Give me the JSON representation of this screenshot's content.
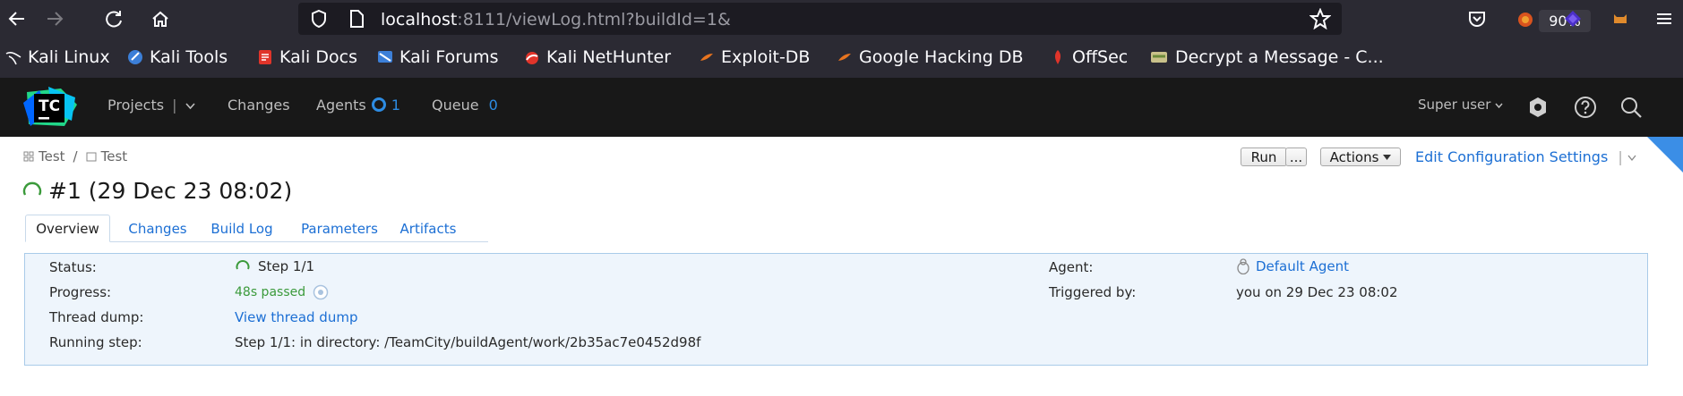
{
  "browser": {
    "url_host": "localhost",
    "url_rest": ":8111/viewLog.html?buildId=1&",
    "zoom": "90%",
    "bookmarks": [
      {
        "label": "Kali Linux",
        "icon": "kali-dragon-icon"
      },
      {
        "label": "Kali Tools",
        "icon": "kali-tools-icon"
      },
      {
        "label": "Kali Docs",
        "icon": "kali-docs-icon"
      },
      {
        "label": "Kali Forums",
        "icon": "kali-forums-icon"
      },
      {
        "label": "Kali NetHunter",
        "icon": "nethunter-icon"
      },
      {
        "label": "Exploit-DB",
        "icon": "exploit-db-icon"
      },
      {
        "label": "Google Hacking DB",
        "icon": "ghdb-icon"
      },
      {
        "label": "OffSec",
        "icon": "offsec-icon"
      },
      {
        "label": "Decrypt a Message - C...",
        "icon": "decrypt-icon"
      }
    ]
  },
  "header": {
    "logo_text": "TC",
    "projects": "Projects",
    "changes": "Changes",
    "agents": "Agents",
    "agents_count": "1",
    "queue": "Queue",
    "queue_count": "0",
    "user": "Super user"
  },
  "breadcrumb": {
    "project": "Test",
    "separator": "/",
    "config": "Test"
  },
  "build": {
    "title": "#1 (29 Dec 23 08:02)"
  },
  "toolbar": {
    "run": "Run",
    "run_more": "...",
    "actions": "Actions",
    "edit_config": "Edit Configuration Settings"
  },
  "tabs": [
    "Overview",
    "Changes",
    "Build Log",
    "Parameters",
    "Artifacts"
  ],
  "details": {
    "status_label": "Status:",
    "status_value": "Step 1/1",
    "progress_label": "Progress:",
    "progress_value": "48s passed",
    "thread_label": "Thread dump:",
    "thread_value": "View thread dump",
    "running_label": "Running step:",
    "running_value": "Step 1/1: in directory: /TeamCity/buildAgent/work/2b35ac7e0452d98f",
    "agent_label": "Agent:",
    "agent_value": "Default Agent",
    "triggered_label": "Triggered by:",
    "triggered_value": "you on 29 Dec 23 08:02"
  },
  "colors": {
    "accent": "#1c6fd4",
    "running": "#3b9a3b",
    "header_bg": "#181818",
    "browser_bg": "#2b2a33"
  }
}
